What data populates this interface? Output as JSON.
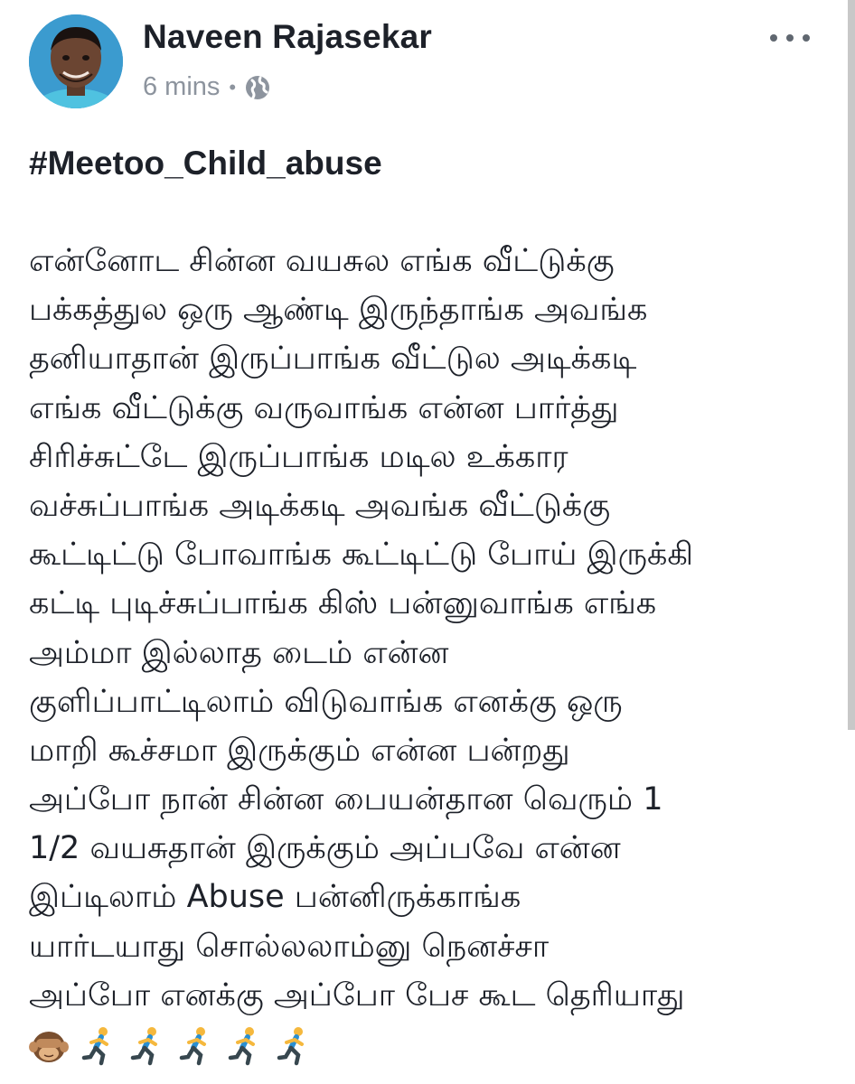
{
  "post": {
    "author": "Naveen Rajasekar",
    "time": "6 mins",
    "separator": "•",
    "privacy_icon": "globe-icon",
    "more_icon": "more-options-icon",
    "hashtag": "#Meetoo_Child_abuse",
    "lines": [
      "என்னோட சின்ன வயசுல எங்க வீட்டுக்கு",
      "பக்கத்துல ஒரு ஆண்டி இருந்தாங்க அவங்க",
      "தனியாதான் இருப்பாங்க வீட்டுல அடிக்கடி",
      "எங்க வீட்டுக்கு வருவாங்க என்ன பார்த்து",
      "சிரிச்சுட்டே இருப்பாங்க மடில உக்கார",
      "வச்சுப்பாங்க அடிக்கடி அவங்க வீட்டுக்கு",
      "கூட்டிட்டு போவாங்க கூட்டிட்டு போய் இருக்கி",
      "கட்டி புடிச்சுப்பாங்க கிஸ் பன்னுவாங்க எங்க",
      "அம்மா இல்லாத டைம் என்ன",
      "குளிப்பாட்டிலாம் விடுவாங்க எனக்கு ஒரு",
      "மாறி கூச்சமா இருக்கும் என்ன பன்றது",
      "அப்போ நான் சின்ன பையன்தான வெரும் 1",
      "1/2 வயசுதான் இருக்கும் அப்பவே என்ன",
      "இப்டிலாம் Abuse பன்னிருக்காங்க",
      "யார்டயாது சொல்லலாம்னு நெனச்சா",
      "அப்போ எனக்கு அப்போ பேச கூட தெரியாது"
    ],
    "emojis": [
      "see-no-evil-monkey-icon",
      "running-man-icon",
      "running-man-icon",
      "running-man-icon",
      "running-man-icon",
      "running-man-icon"
    ]
  }
}
